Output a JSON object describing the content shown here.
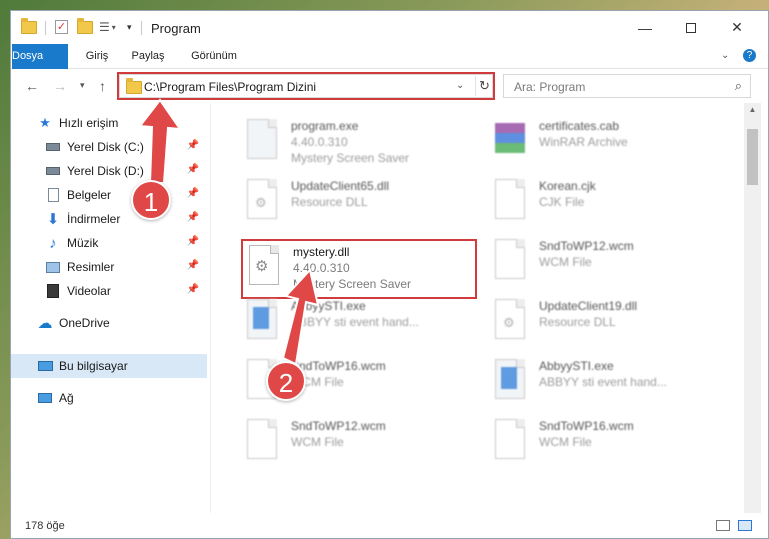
{
  "window": {
    "title": "Program"
  },
  "ribbon": {
    "tabs": [
      "Dosya",
      "Giriş",
      "Paylaş",
      "Görünüm"
    ]
  },
  "address": {
    "path": "C:\\Program Files\\Program Dizini"
  },
  "search": {
    "placeholder": "Ara: Program"
  },
  "sidebar": {
    "items": [
      {
        "label": "Hızlı erişim",
        "icon": "star-icon"
      },
      {
        "label": "Yerel Disk (C:)",
        "icon": "drive-icon"
      },
      {
        "label": "Yerel Disk (D:)",
        "icon": "drive-icon"
      },
      {
        "label": "Belgeler",
        "icon": "documents-icon"
      },
      {
        "label": "İndirmeler",
        "icon": "download-icon"
      },
      {
        "label": "Müzik",
        "icon": "music-icon"
      },
      {
        "label": "Resimler",
        "icon": "pictures-icon"
      },
      {
        "label": "Videolar",
        "icon": "video-icon"
      },
      {
        "label": "OneDrive",
        "icon": "cloud-icon"
      },
      {
        "label": "Bu bilgisayar",
        "icon": "computer-icon"
      },
      {
        "label": "Ağ",
        "icon": "network-icon"
      }
    ]
  },
  "files": [
    {
      "name": "program.exe",
      "line2": "4.40.0.310",
      "line3": "Mystery Screen Saver"
    },
    {
      "name": "certificates.cab",
      "line2": "WinRAR Archive",
      "line3": ""
    },
    {
      "name": "UpdateClient65.dll",
      "line2": "Resource DLL",
      "line3": ""
    },
    {
      "name": "Korean.cjk",
      "line2": "CJK File",
      "line3": ""
    },
    {
      "name": "mystery.dll",
      "line2": "4.40.0.310",
      "line3": "Mystery Screen Saver"
    },
    {
      "name": "SndToWP12.wcm",
      "line2": "WCM File",
      "line3": ""
    },
    {
      "name": "AbbyySTI.exe",
      "line2": "ABBYY sti event hand...",
      "line3": ""
    },
    {
      "name": "UpdateClient19.dll",
      "line2": "Resource DLL",
      "line3": ""
    },
    {
      "name": "SndToWP16.wcm",
      "line2": "WCM File",
      "line3": ""
    },
    {
      "name": "AbbyySTI.exe",
      "line2": "ABBYY sti event hand...",
      "line3": ""
    },
    {
      "name": "SndToWP12.wcm",
      "line2": "WCM File",
      "line3": ""
    },
    {
      "name": "SndToWP16.wcm",
      "line2": "WCM File",
      "line3": ""
    }
  ],
  "status": {
    "count": "178 öğe"
  },
  "callouts": [
    "1",
    "2"
  ],
  "colors": {
    "accent": "#1979ca",
    "highlight": "#d23b3b",
    "callout": "#e04848"
  }
}
